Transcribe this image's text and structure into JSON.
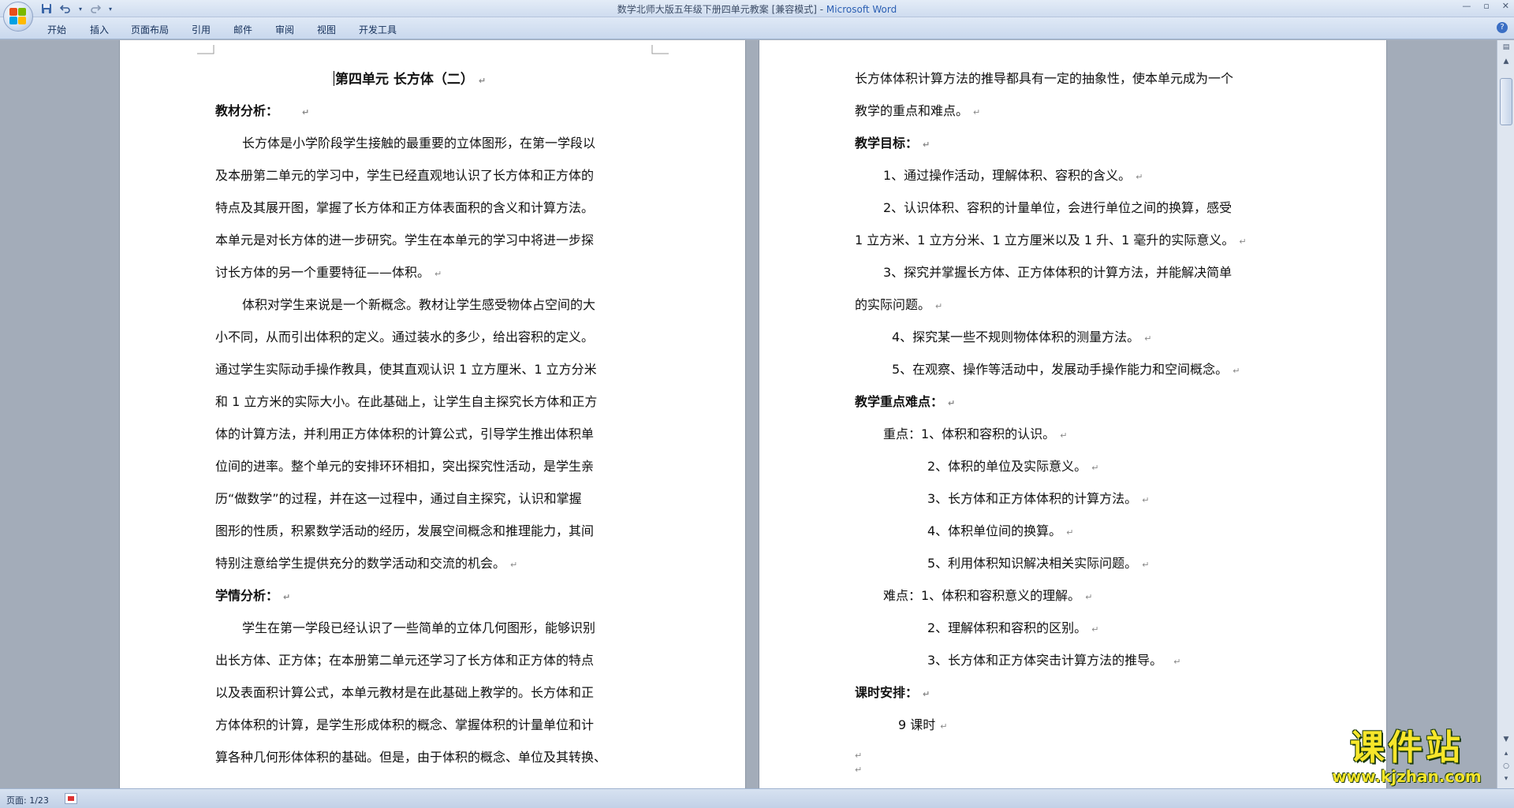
{
  "window": {
    "title_doc": "数学北师大版五年级下册四单元教案 [兼容模式] - ",
    "title_app": "Microsoft Word"
  },
  "quick_access": {
    "save_icon": "save-icon",
    "undo_icon": "undo-icon",
    "redo_icon": "redo-icon",
    "customize_icon": "dropdown-arrow-icon"
  },
  "ribbon": {
    "tabs": [
      "开始",
      "插入",
      "页面布局",
      "引用",
      "邮件",
      "审阅",
      "视图",
      "开发工具"
    ]
  },
  "document": {
    "page1": {
      "lines": [
        "第四单元 长方体（二）",
        "教材分析：",
        "长方体是小学阶段学生接触的最重要的立体图形，在第一学段以",
        "及本册第二单元的学习中，学生已经直观地认识了长方体和正方体的",
        "特点及其展开图，掌握了长方体和正方体表面积的含义和计算方法。",
        "本单元是对长方体的进一步研究。学生在本单元的学习中将进一步探",
        "讨长方体的另一个重要特征——体积。",
        "体积对学生来说是一个新概念。教材让学生感受物体占空间的大",
        "小不同，从而引出体积的定义。通过装水的多少，给出容积的定义。",
        "通过学生实际动手操作教具，使其直观认识 1 立方厘米、1 立方分米",
        "和 1 立方米的实际大小。在此基础上，让学生自主探究长方体和正方",
        "体的计算方法，并利用正方体体积的计算公式，引导学生推出体积单",
        "位间的进率。整个单元的安排环环相扣，突出探究性活动，是学生亲",
        "历“做数学”的过程，并在这一过程中，通过自主探究，认识和掌握",
        "图形的性质，积累数学活动的经历，发展空间概念和推理能力，其间",
        "特别注意给学生提供充分的数学活动和交流的机会。",
        "学情分析：",
        "学生在第一学段已经认识了一些简单的立体几何图形，能够识别",
        "出长方体、正方体；在本册第二单元还学习了长方体和正方体的特点",
        "以及表面积计算公式，本单元教材是在此基础上教学的。长方体和正",
        "方体体积的计算，是学生形成体积的概念、掌握体积的计量单位和计",
        "算各种几何形体体积的基础。但是，由于体积的概念、单位及其转换、"
      ]
    },
    "page2": {
      "lines": [
        "长方体体积计算方法的推导都具有一定的抽象性，使本单元成为一个",
        "教学的重点和难点。",
        "教学目标：",
        "1、通过操作活动，理解体积、容积的含义。",
        "2、认识体积、容积的计量单位，会进行单位之间的换算，感受",
        "1 立方米、1 立方分米、1 立方厘米以及 1 升、1 毫升的实际意义。",
        "3、探究并掌握长方体、正方体体积的计算方法，并能解决简单",
        "的实际问题。",
        "4、探究某一些不规则物体体积的测量方法。",
        "5、在观察、操作等活动中，发展动手操作能力和空间概念。",
        "教学重点难点：",
        "重点：1、体积和容积的认识。",
        "2、体积的单位及实际意义。",
        "3、长方体和正方体体积的计算方法。",
        "4、体积单位间的换算。",
        "5、利用体积知识解决相关实际问题。",
        "难点：1、体积和容积意义的理解。",
        "2、理解体积和容积的区别。",
        "3、长方体和正方体突击计算方法的推导。",
        "课时安排：",
        "9 课时",
        "",
        ""
      ]
    },
    "paragraph_mark": "↵"
  },
  "status_bar": {
    "page_info": "页面: 1/23",
    "proofing_icon": "proofing-errors-icon"
  },
  "watermark": {
    "logo_text": "课件站",
    "url": "www.kjzhan.com"
  },
  "colors": {
    "ribbon_bg": "#dfe9f6",
    "doc_bg": "#a3acb9",
    "title_app": "#2b5fb3",
    "watermark": "#f7e62a"
  }
}
